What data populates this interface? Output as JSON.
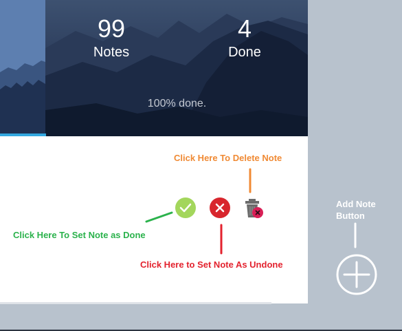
{
  "stats": {
    "notes": {
      "count": "99",
      "label": "Notes"
    },
    "done": {
      "count": "4",
      "label": "Done"
    }
  },
  "progress": {
    "text": "100% done.",
    "fraction": 0.15
  },
  "annotations": {
    "delete": "Click Here To Delete Note",
    "set_done": "Click Here To Set Note as Done",
    "set_undone": "Click Here to Set Note As Undone",
    "add": "Add Note Button"
  },
  "colors": {
    "done": "#a3d65c",
    "undone": "#d8262d",
    "delete_label": "#f08a34",
    "done_label": "#2bb24c",
    "undone_label": "#e3222e",
    "progress": "#33a8e0"
  },
  "icons": {
    "done": "check-icon",
    "undone": "close-icon",
    "delete": "trash-icon",
    "add": "plus-icon"
  }
}
